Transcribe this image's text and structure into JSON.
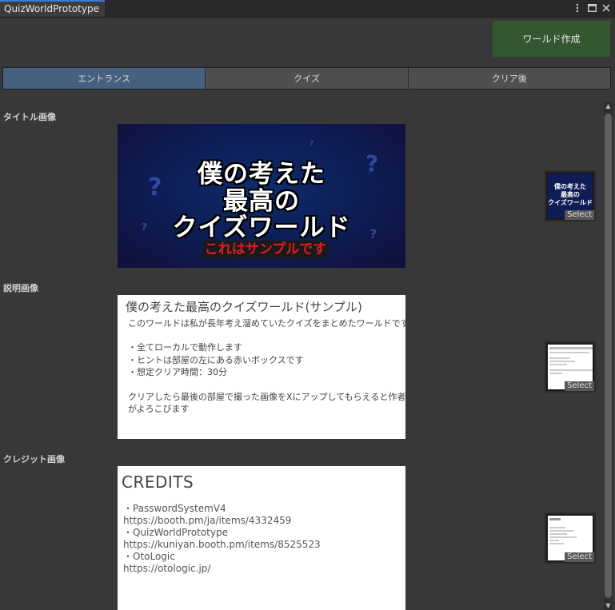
{
  "window": {
    "tab_title": "QuizWorldPrototype",
    "icons": [
      "more-icon",
      "maximize-icon",
      "close-icon"
    ]
  },
  "toolbar": {
    "build_label": "ワールド作成"
  },
  "tabs": [
    {
      "label": "エントランス",
      "active": true
    },
    {
      "label": "クイズ",
      "active": false
    },
    {
      "label": "クリア後",
      "active": false
    }
  ],
  "sections": {
    "title_image": {
      "label": "タイトル画像",
      "lines": [
        "僕の考えた",
        "最高の",
        "クイズワールド"
      ],
      "sample": "これはサンプルです",
      "thumb_lines": [
        "僕の考えた",
        "最高の",
        "クイズワールド"
      ],
      "select": "Select"
    },
    "description_image": {
      "label": "説明画像",
      "heading": "僕の考えた最高のクイズワールド(サンプル)",
      "lines": [
        "このワールドは私が長年考え溜めていたクイズをまとめたワールドです",
        "・全てローカルで動作します",
        "・ヒントは部屋の左にある赤いボックスです",
        "・想定クリア時間：30分",
        "クリアしたら最後の部屋で撮った画像をXにアップしてもらえると作者",
        "がよろこびます"
      ],
      "select": "Select"
    },
    "credit_image": {
      "label": "クレジット画像",
      "heading": "CREDITS",
      "lines": [
        "・PasswordSystemV4",
        "https://booth.pm/ja/items/4332459",
        "・QuizWorldPrototype",
        "https://kuniyan.booth.pm/items/8525523",
        "・OtoLogic",
        "https://otologic.jp/"
      ],
      "select": "Select"
    }
  },
  "colors": {
    "background": "#383838",
    "active_tab": "#46607f",
    "build_button": "#345732",
    "sample_red": "#e21b23"
  }
}
